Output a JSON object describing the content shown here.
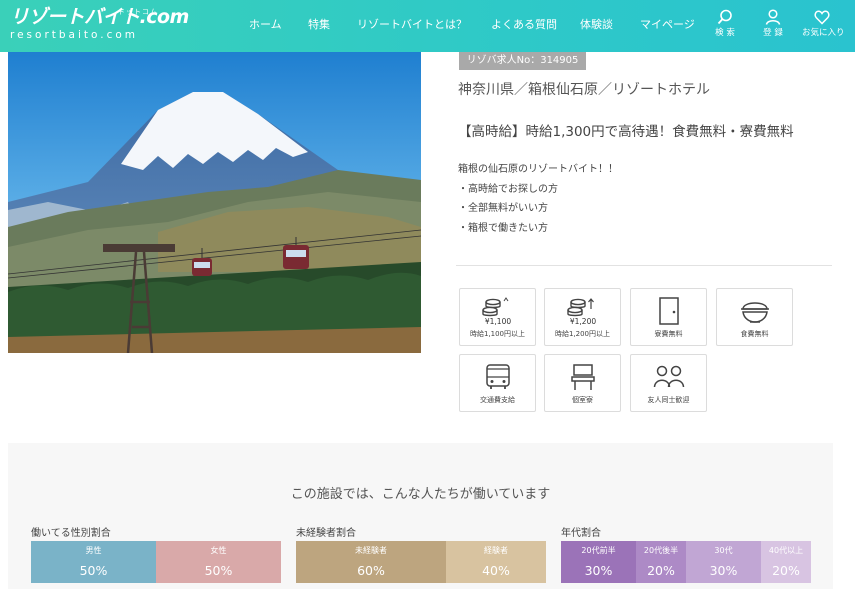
{
  "header": {
    "logo_text": "リゾートバイト.com",
    "logo_small": "ドットコム",
    "logo_sub": "resortbaito.com",
    "nav": [
      {
        "label": "ホーム"
      },
      {
        "label": "特集"
      },
      {
        "label": "リゾートバイトとは？"
      },
      {
        "label": "よくある質問"
      },
      {
        "label": "体験談"
      },
      {
        "label": "マイページ"
      }
    ],
    "icons": [
      {
        "label": "検 索",
        "icon": "search-icon"
      },
      {
        "label": "登 録",
        "icon": "user-icon"
      },
      {
        "label": "お気に入り",
        "icon": "heart-icon"
      }
    ],
    "colors": {
      "start": "#3ad0b9",
      "end": "#2ac3cf"
    }
  },
  "job": {
    "number": "リゾバ求人No：314905",
    "location": "神奈川県／箱根仙石原／リゾートホテル",
    "headline": "【高時給】時給1,300円で高待遇！食費無料・寮費無料",
    "description": [
      "箱根の仙石原のリゾートバイト！！",
      "・高時給でお探しの方",
      "・全部無料がいい方",
      "・箱根で働きたい方"
    ]
  },
  "features": [
    {
      "label": "時給1,100円以上",
      "icon": "coins-1100-icon",
      "amount": "¥1,100"
    },
    {
      "label": "時給1,200円以上",
      "icon": "coins-1200-icon",
      "amount": "¥1,200"
    },
    {
      "label": "寮費無料",
      "icon": "door-icon"
    },
    {
      "label": "食費無料",
      "icon": "rice-bowl-icon"
    },
    {
      "label": "交通費支給",
      "icon": "bus-icon"
    },
    {
      "label": "個室寮",
      "icon": "chair-icon"
    },
    {
      "label": "友人同士歓迎",
      "icon": "friends-icon"
    }
  ],
  "stats": {
    "title": "この施設では、こんな人たちが働いています",
    "gender": {
      "label": "働いてる性別割合",
      "items": [
        {
          "name": "男性",
          "value": "50%",
          "fraction": 0.5,
          "color": "#7ab3c8"
        },
        {
          "name": "女性",
          "value": "50%",
          "fraction": 0.5,
          "color": "#d9a9a9"
        }
      ]
    },
    "experience": {
      "label": "未経験者割合",
      "items": [
        {
          "name": "未経験者",
          "value": "60%",
          "fraction": 0.6,
          "color": "#bda57f"
        },
        {
          "name": "経験者",
          "value": "40%",
          "fraction": 0.4,
          "color": "#d8c3a0"
        }
      ]
    },
    "age": {
      "label": "年代割合",
      "items": [
        {
          "name": "20代前半",
          "value": "30%",
          "fraction": 0.3,
          "color": "#9b73b8"
        },
        {
          "name": "20代後半",
          "value": "20%",
          "fraction": 0.2,
          "color": "#ad8ac6"
        },
        {
          "name": "30代",
          "value": "30%",
          "fraction": 0.3,
          "color": "#c1a6d4"
        },
        {
          "name": "40代以上",
          "value": "20%",
          "fraction": 0.2,
          "color": "#d8c4e2"
        }
      ]
    }
  }
}
